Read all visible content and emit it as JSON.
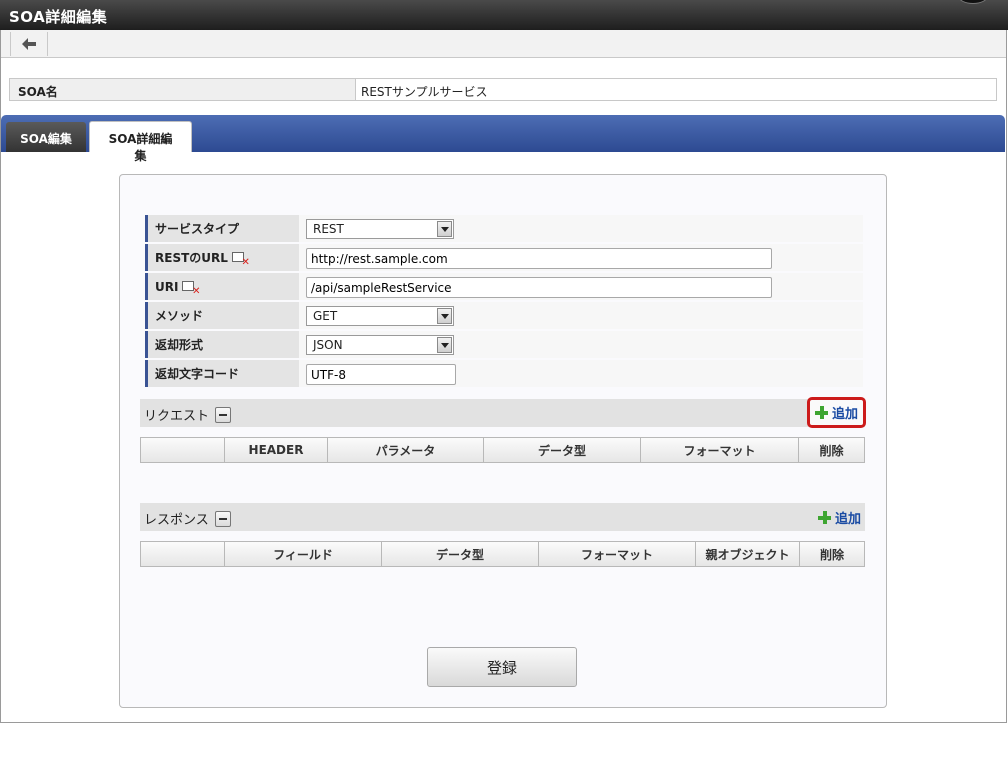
{
  "window": {
    "title": "SOA詳細編集"
  },
  "toolbar": {
    "back_icon": "back-arrow-icon"
  },
  "soa_name": {
    "label": "SOA名",
    "value": "RESTサンプルサービス"
  },
  "tabs": [
    {
      "label": "SOA編集",
      "active": false
    },
    {
      "label": "SOA詳細編集",
      "active": true
    }
  ],
  "form": {
    "service_type": {
      "label": "サービスタイプ",
      "value": "REST"
    },
    "rest_url": {
      "label": "RESTのURL",
      "value": "http://rest.sample.com"
    },
    "uri": {
      "label": "URI",
      "value": "/api/sampleRestService"
    },
    "method": {
      "label": "メソッド",
      "value": "GET"
    },
    "return_format": {
      "label": "返却形式",
      "value": "JSON"
    },
    "return_charset": {
      "label": "返却文字コード",
      "value": "UTF-8"
    }
  },
  "request": {
    "title": "リクエスト",
    "add_label": "追加",
    "columns": [
      "",
      "HEADER",
      "パラメータ",
      "データ型",
      "フォーマット",
      "削除"
    ]
  },
  "response": {
    "title": "レスポンス",
    "add_label": "追加",
    "columns": [
      "",
      "フィールド",
      "データ型",
      "フォーマット",
      "親オブジェクト",
      "削除"
    ]
  },
  "register_button": "登録",
  "colors": {
    "tab_bar": "#2d4a92",
    "accent_label_border": "#3a5394",
    "add_link": "#1a4ba3",
    "highlight_border": "#cc1b1b",
    "plus_icon": "#3ea531"
  }
}
